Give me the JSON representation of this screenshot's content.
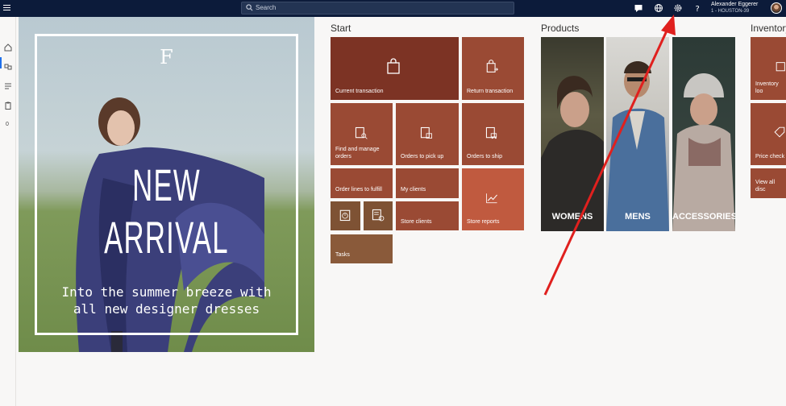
{
  "topbar": {
    "search_placeholder": "Search",
    "user_name": "Alexander Eggerer",
    "user_store": "1 - HOUSTON-39",
    "icons": [
      "hamburger-icon",
      "search-icon",
      "chat-icon",
      "globe-icon",
      "gear-icon",
      "help-icon"
    ]
  },
  "rail": {
    "count": "0"
  },
  "banner": {
    "logo": "F",
    "headline": "NEW ARRIVAL",
    "subtitle_line1": "Into the summer breeze with",
    "subtitle_line2": "all new designer dresses"
  },
  "sections": {
    "start": "Start",
    "products": "Products",
    "inventory": "Inventory"
  },
  "start_tiles": {
    "current_transaction": "Current transaction",
    "return_transaction": "Return transaction",
    "find_orders_1": "Find and manage",
    "find_orders_2": "orders",
    "orders_pickup": "Orders to pick up",
    "orders_ship": "Orders to ship",
    "order_lines": "Order lines to fulfill",
    "my_clients": "My clients",
    "store_reports": "Store reports",
    "store_clients": "Store clients",
    "tasks": "Tasks"
  },
  "products": {
    "womens": "WOMENS",
    "mens": "MENS",
    "accessories": "ACCESSORIES"
  },
  "inventory": {
    "lookup": "Inventory loo",
    "price_check": "Price check",
    "view_all": "View all disc"
  },
  "colors": {
    "topbar": "#0c1b3a",
    "tile_rust": "#9a4a34",
    "tile_bright": "#c05a3f",
    "tile_brown": "#7e5234",
    "annotation_arrow": "#e0201e"
  }
}
